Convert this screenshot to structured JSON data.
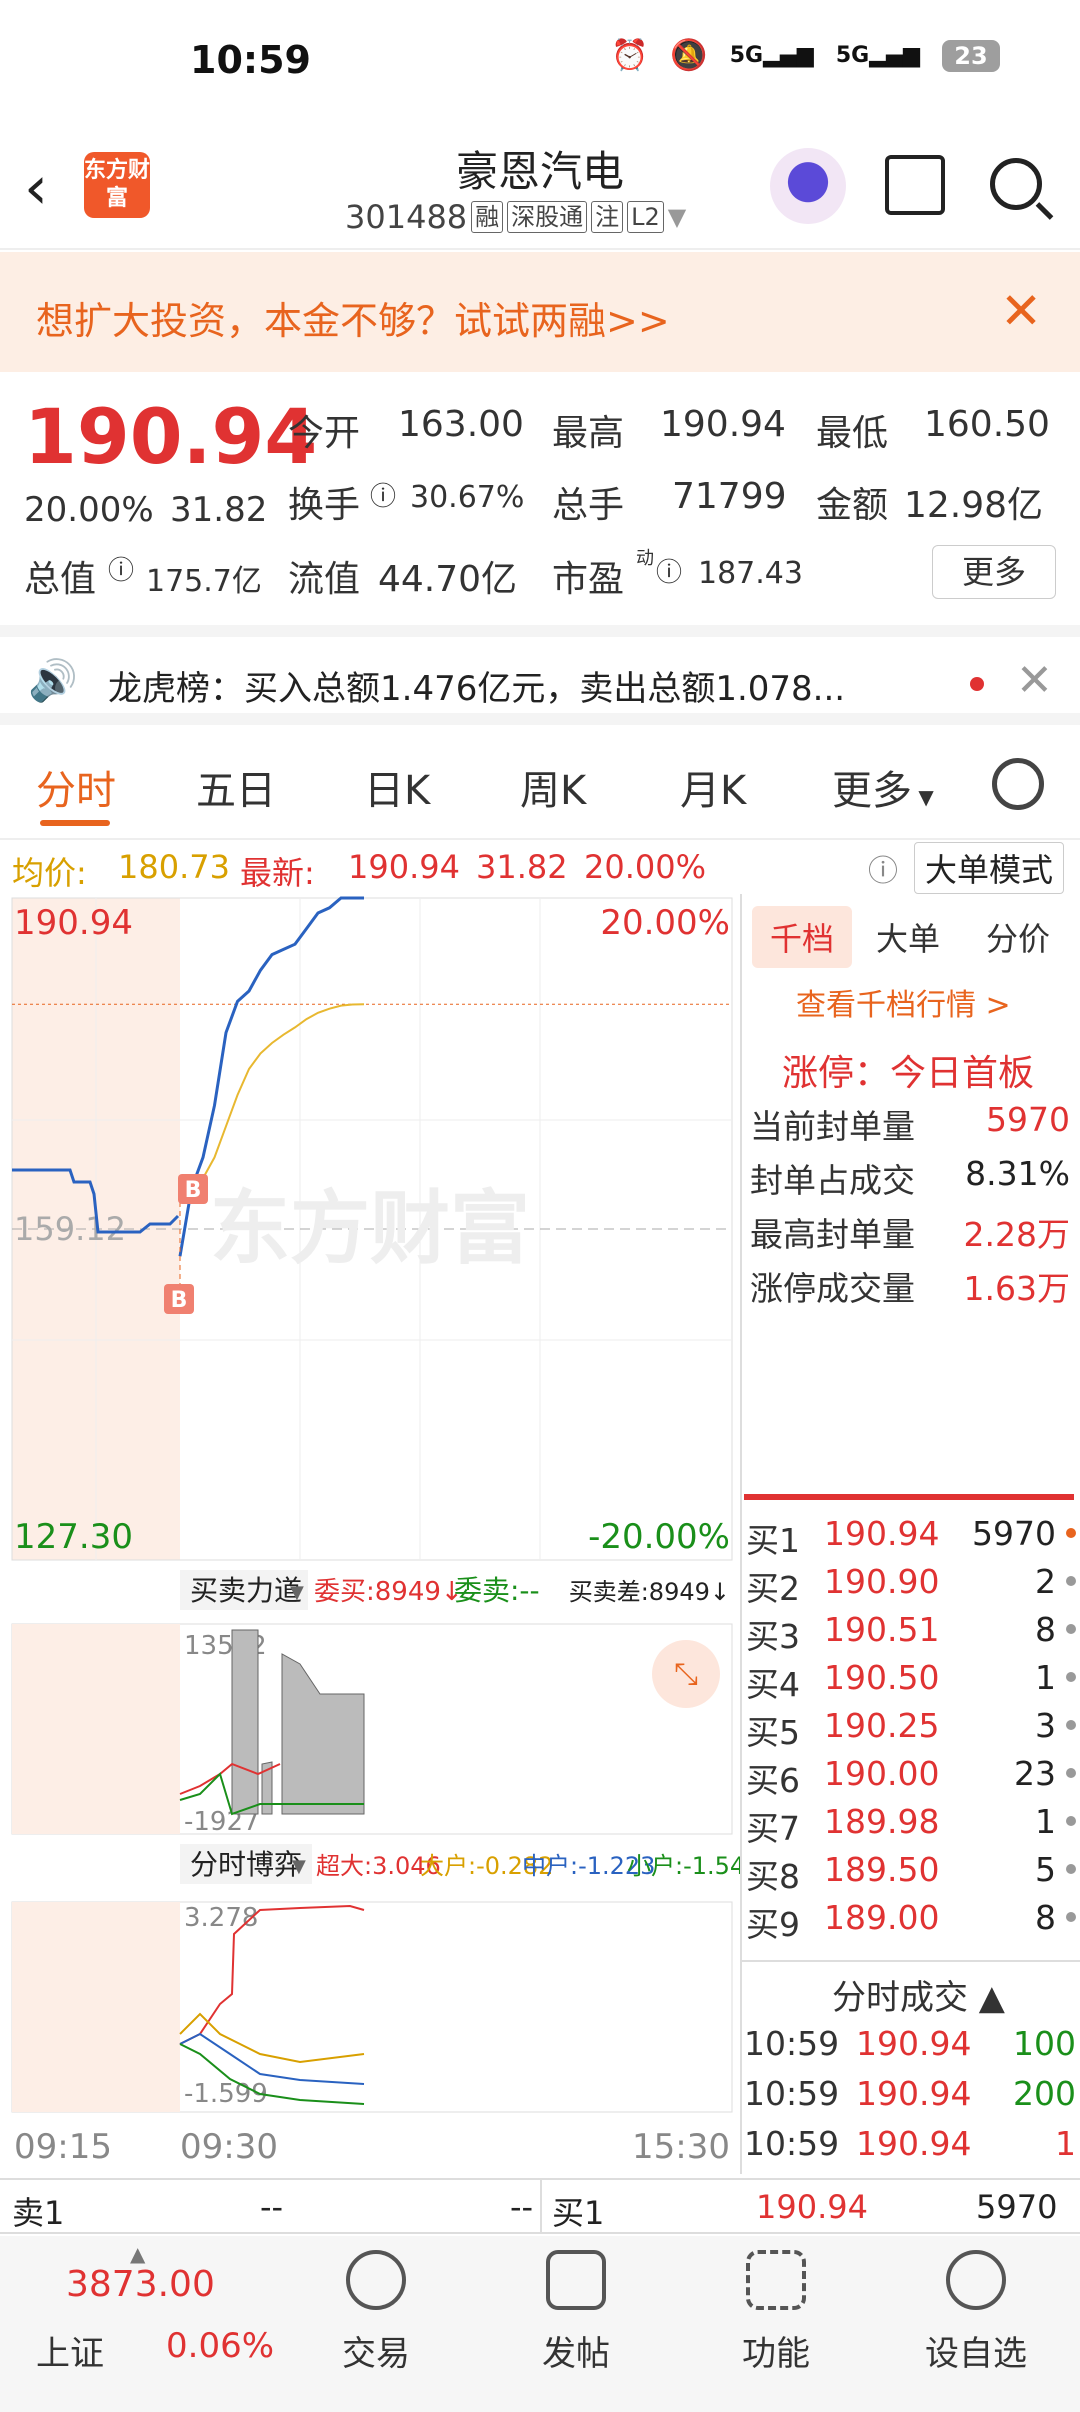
{
  "status_bar": {
    "time": "10:59",
    "battery": "23",
    "net1": "5G",
    "net2": "5G"
  },
  "header": {
    "back_icon": "chevron-left-icon",
    "logo_text": "东方财富",
    "stock_name": "豪恩汽电",
    "stock_code": "301488",
    "tags": [
      "融",
      "深股通",
      "注",
      "L2"
    ]
  },
  "promo": {
    "text": "想扩大投资，本金不够？试试两融>>"
  },
  "quote": {
    "price": "190.94",
    "change_pct": "20.00%",
    "change_amt": "31.82",
    "open_label": "今开",
    "open": "163.00",
    "high_label": "最高",
    "high": "190.94",
    "low_label": "最低",
    "low": "160.50",
    "turnover_label": "换手",
    "turnover": "30.67%",
    "volume_label": "总手",
    "volume": "71799",
    "amount_label": "金额",
    "amount": "12.98亿",
    "mktcap_label": "总值",
    "mktcap": "175.7亿",
    "float_label": "流值",
    "float": "44.70亿",
    "pe_label": "市盈",
    "pe_sup": "动",
    "pe": "187.43",
    "more": "更多"
  },
  "notice": {
    "text": "龙虎榜：买入总额1.476亿元，卖出总额1.078..."
  },
  "tabs": [
    "分时",
    "五日",
    "日K",
    "周K",
    "月K",
    "更多"
  ],
  "infobar": {
    "avg_label": "均价:",
    "avg": "180.73",
    "latest_label": "最新:",
    "latest": "190.94",
    "chg": "31.82",
    "pct": "20.00%",
    "mode": "大单模式"
  },
  "chart": {
    "top_price": "190.94",
    "top_pct": "20.00%",
    "mid_price": "159.12",
    "bottom_price": "127.30",
    "bottom_pct": "-20.00%",
    "watermark": "东方财富",
    "sub1_label": "买卖力道",
    "sub1_buy": "委买:8949↓",
    "sub1_sell": "委卖:--",
    "sub1_diff": "买卖差:8949↓",
    "sub1_max": "13542",
    "sub1_min": "-1927",
    "sub2_label": "分时博弈",
    "sub2_super": "超大:3.046",
    "sub2_big": "大户:-0.282",
    "sub2_mid": "中户:-1.223",
    "sub2_small": "小户:-1.541",
    "sub2_max": "3.278",
    "sub2_min": "-1.599",
    "time_start": "09:15",
    "time_open": "09:30",
    "time_end": "15:30"
  },
  "chart_data": {
    "type": "line",
    "title": "",
    "x": [
      "09:25",
      "09:30",
      "09:31",
      "09:32",
      "09:33",
      "09:35",
      "09:40",
      "09:45",
      "09:50",
      "09:55",
      "10:00",
      "10:10",
      "10:20",
      "10:30",
      "10:40",
      "10:50",
      "10:59"
    ],
    "series": [
      {
        "name": "price",
        "values": [
          156.5,
          163.0,
          166.0,
          171.0,
          178.0,
          181.0,
          182.0,
          184.0,
          185.5,
          186.0,
          186.5,
          188.0,
          189.5,
          190.0,
          190.94,
          190.94,
          190.94
        ]
      },
      {
        "name": "avg",
        "values": [
          null,
          163.0,
          164.0,
          166.0,
          169.0,
          172.0,
          174.5,
          176.0,
          177.0,
          177.8,
          178.5,
          179.3,
          179.9,
          180.3,
          180.6,
          180.7,
          180.73
        ]
      }
    ],
    "ylim": [
      127.3,
      190.94
    ],
    "prev_close": 159.12
  },
  "right_panel": {
    "tabs": [
      "千档",
      "大单",
      "分价"
    ],
    "link": "查看千档行情 >",
    "limit_title": "涨停：今日首板",
    "seal": [
      {
        "label": "当前封单量",
        "value": "5970"
      },
      {
        "label": "封单占成交",
        "value": "8.31%"
      },
      {
        "label": "最高封单量",
        "value": "2.28万"
      },
      {
        "label": "涨停成交量",
        "value": "1.63万"
      }
    ],
    "bids": [
      {
        "label": "买1",
        "price": "190.94",
        "vol": "5970"
      },
      {
        "label": "买2",
        "price": "190.90",
        "vol": "2"
      },
      {
        "label": "买3",
        "price": "190.51",
        "vol": "8"
      },
      {
        "label": "买4",
        "price": "190.50",
        "vol": "1"
      },
      {
        "label": "买5",
        "price": "190.25",
        "vol": "3"
      },
      {
        "label": "买6",
        "price": "190.00",
        "vol": "23"
      },
      {
        "label": "买7",
        "price": "189.98",
        "vol": "1"
      },
      {
        "label": "买8",
        "price": "189.50",
        "vol": "5"
      },
      {
        "label": "买9",
        "price": "189.00",
        "vol": "8"
      }
    ],
    "trades_title": "分时成交",
    "trades": [
      {
        "time": "10:59",
        "price": "190.94",
        "vol": "100",
        "color": "green"
      },
      {
        "time": "10:59",
        "price": "190.94",
        "vol": "200",
        "color": "green"
      },
      {
        "time": "10:59",
        "price": "190.94",
        "vol": "1",
        "color": "red"
      }
    ]
  },
  "bottom_bar": {
    "sell_label": "卖1",
    "sell_price": "--",
    "sell_vol": "--",
    "buy_label": "买1",
    "buy_price": "190.94",
    "buy_vol": "5970"
  },
  "dock": {
    "index_value": "3873.00",
    "index_name": "上证",
    "index_pct": "0.06%",
    "items": [
      {
        "label": "交易",
        "icon": "trade-icon"
      },
      {
        "label": "发帖",
        "icon": "edit-icon"
      },
      {
        "label": "功能",
        "icon": "grid-icon"
      },
      {
        "label": "设自选",
        "icon": "more-icon"
      }
    ]
  }
}
